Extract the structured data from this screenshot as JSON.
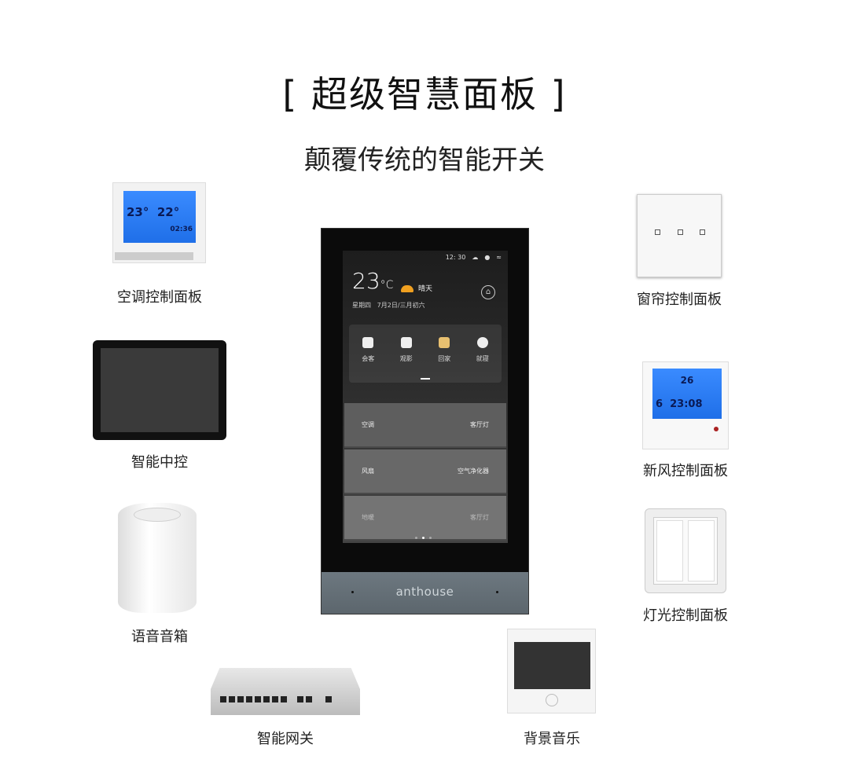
{
  "title": "[ 超级智慧面板 ]",
  "subtitle": "颠覆传统的智能开关",
  "panel": {
    "status": {
      "time": "12: 30"
    },
    "temperature": "23",
    "temp_unit": "°C",
    "weather": "晴天",
    "weekday": "星期四",
    "date": "7月2日/三月初六",
    "scenes": [
      {
        "label": "会客",
        "icon": "coffee-cup-icon"
      },
      {
        "label": "观影",
        "icon": "film-icon"
      },
      {
        "label": "回家",
        "icon": "house-icon"
      },
      {
        "label": "就寝",
        "icon": "moon-icon"
      }
    ],
    "tiles": [
      {
        "left": "空调",
        "right": "客厅灯"
      },
      {
        "left": "风扇",
        "right": "空气净化器"
      },
      {
        "left": "地暖",
        "right": "客厅灯"
      }
    ],
    "brand": "anthouse"
  },
  "devices": {
    "ac_panel": {
      "label": "空调控制面板",
      "temp1": "23",
      "temp2": "22",
      "time": "02:36"
    },
    "central_control": {
      "label": "智能中控"
    },
    "speaker": {
      "label": "语音音箱"
    },
    "gateway": {
      "label": "智能网关"
    },
    "curtain_panel": {
      "label": "窗帘控制面板"
    },
    "fresh_air_panel": {
      "label": "新风控制面板",
      "temp": "26",
      "day": "6",
      "time": "23:08"
    },
    "light_panel": {
      "label": "灯光控制面板"
    },
    "background_music": {
      "label": "背景音乐"
    }
  },
  "colors": {
    "lcd_blue": "#2a7cf5",
    "weather_orange": "#f0a020",
    "strip_gray": "#66717a"
  }
}
